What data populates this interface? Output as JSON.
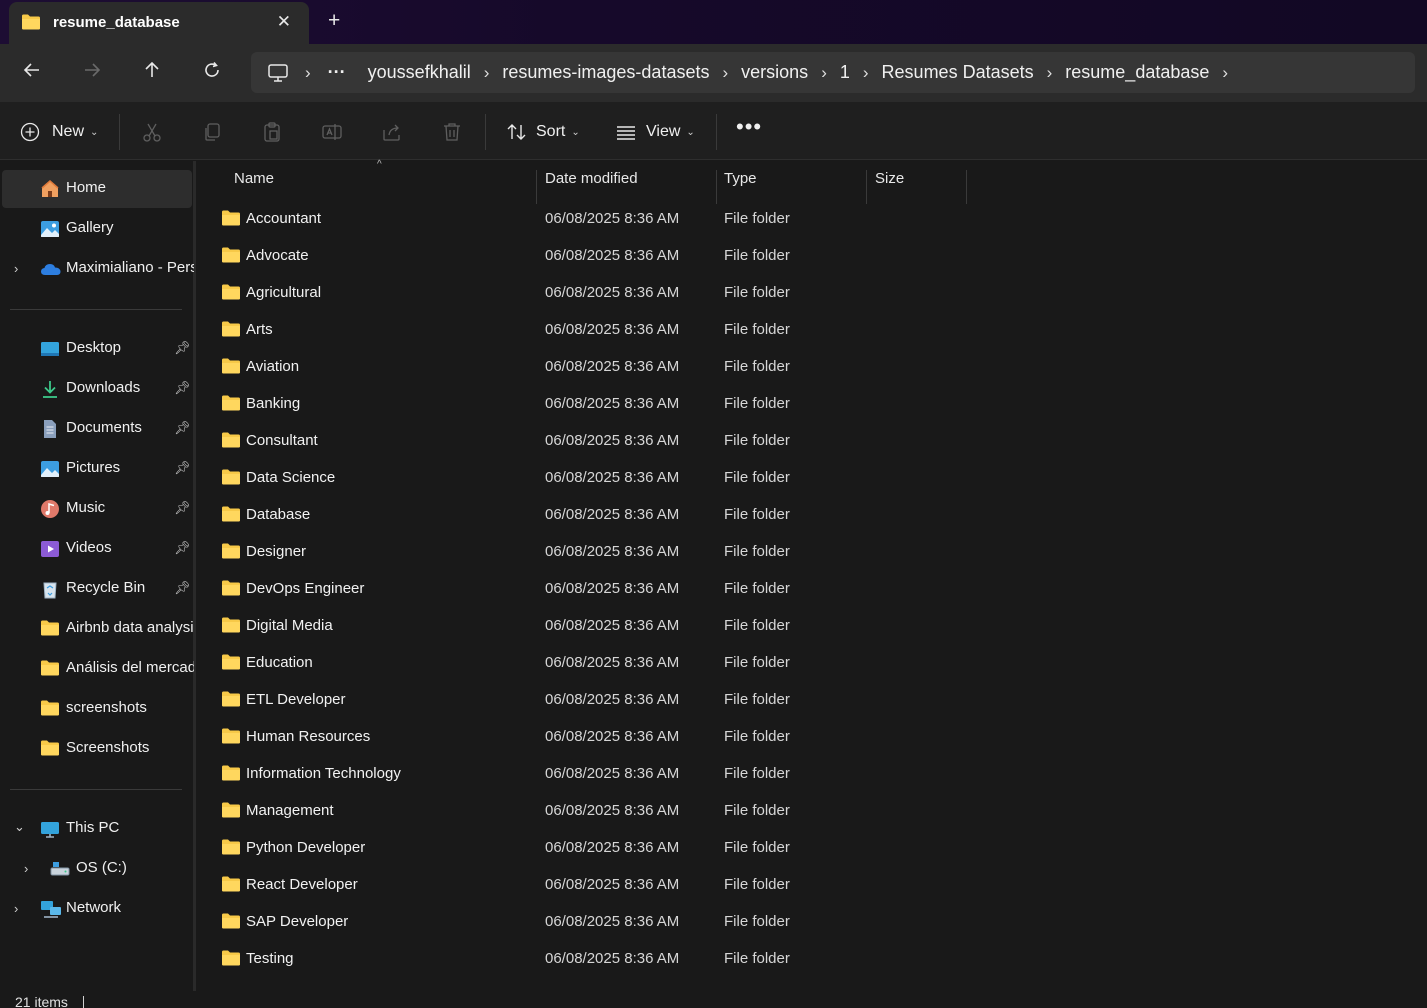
{
  "tab": {
    "title": "resume_database"
  },
  "breadcrumb": [
    "youssefkhalil",
    "resumes-images-datasets",
    "versions",
    "1",
    "Resumes Datasets",
    "resume_database"
  ],
  "command_bar": {
    "new_label": "New",
    "sort_label": "Sort",
    "view_label": "View"
  },
  "sidebar": {
    "home": "Home",
    "gallery": "Gallery",
    "onedrive": "Maximialiano - Personal",
    "quick_access": [
      {
        "label": "Desktop",
        "icon": "desktop-icon"
      },
      {
        "label": "Downloads",
        "icon": "downloads-icon"
      },
      {
        "label": "Documents",
        "icon": "documents-icon"
      },
      {
        "label": "Pictures",
        "icon": "pictures-icon"
      },
      {
        "label": "Music",
        "icon": "music-icon"
      },
      {
        "label": "Videos",
        "icon": "videos-icon"
      },
      {
        "label": "Recycle Bin",
        "icon": "recycle-bin-icon"
      },
      {
        "label": "Airbnb data analysis",
        "icon": "folder-icon"
      },
      {
        "label": "Análisis del mercado",
        "icon": "folder-icon"
      },
      {
        "label": "screenshots",
        "icon": "folder-icon"
      },
      {
        "label": "Screenshots",
        "icon": "folder-icon"
      }
    ],
    "this_pc": "This PC",
    "os_drive": "OS (C:)",
    "network": "Network"
  },
  "columns": {
    "name": "Name",
    "date": "Date modified",
    "type": "Type",
    "size": "Size"
  },
  "files": [
    {
      "name": "Accountant",
      "date": "06/08/2025 8:36 AM",
      "type": "File folder"
    },
    {
      "name": "Advocate",
      "date": "06/08/2025 8:36 AM",
      "type": "File folder"
    },
    {
      "name": "Agricultural",
      "date": "06/08/2025 8:36 AM",
      "type": "File folder"
    },
    {
      "name": "Arts",
      "date": "06/08/2025 8:36 AM",
      "type": "File folder"
    },
    {
      "name": "Aviation",
      "date": "06/08/2025 8:36 AM",
      "type": "File folder"
    },
    {
      "name": "Banking",
      "date": "06/08/2025 8:36 AM",
      "type": "File folder"
    },
    {
      "name": "Consultant",
      "date": "06/08/2025 8:36 AM",
      "type": "File folder"
    },
    {
      "name": "Data Science",
      "date": "06/08/2025 8:36 AM",
      "type": "File folder"
    },
    {
      "name": "Database",
      "date": "06/08/2025 8:36 AM",
      "type": "File folder"
    },
    {
      "name": "Designer",
      "date": "06/08/2025 8:36 AM",
      "type": "File folder"
    },
    {
      "name": "DevOps Engineer",
      "date": "06/08/2025 8:36 AM",
      "type": "File folder"
    },
    {
      "name": "Digital Media",
      "date": "06/08/2025 8:36 AM",
      "type": "File folder"
    },
    {
      "name": "Education",
      "date": "06/08/2025 8:36 AM",
      "type": "File folder"
    },
    {
      "name": "ETL Developer",
      "date": "06/08/2025 8:36 AM",
      "type": "File folder"
    },
    {
      "name": "Human Resources",
      "date": "06/08/2025 8:36 AM",
      "type": "File folder"
    },
    {
      "name": "Information Technology",
      "date": "06/08/2025 8:36 AM",
      "type": "File folder"
    },
    {
      "name": "Management",
      "date": "06/08/2025 8:36 AM",
      "type": "File folder"
    },
    {
      "name": "Python Developer",
      "date": "06/08/2025 8:36 AM",
      "type": "File folder"
    },
    {
      "name": "React Developer",
      "date": "06/08/2025 8:36 AM",
      "type": "File folder"
    },
    {
      "name": "SAP Developer",
      "date": "06/08/2025 8:36 AM",
      "type": "File folder"
    },
    {
      "name": "Testing",
      "date": "06/08/2025 8:36 AM",
      "type": "File folder"
    }
  ],
  "status": {
    "item_count": "21 items"
  },
  "colors": {
    "folder": "#f7c948",
    "background": "#191919",
    "accent": "#60cdff"
  }
}
